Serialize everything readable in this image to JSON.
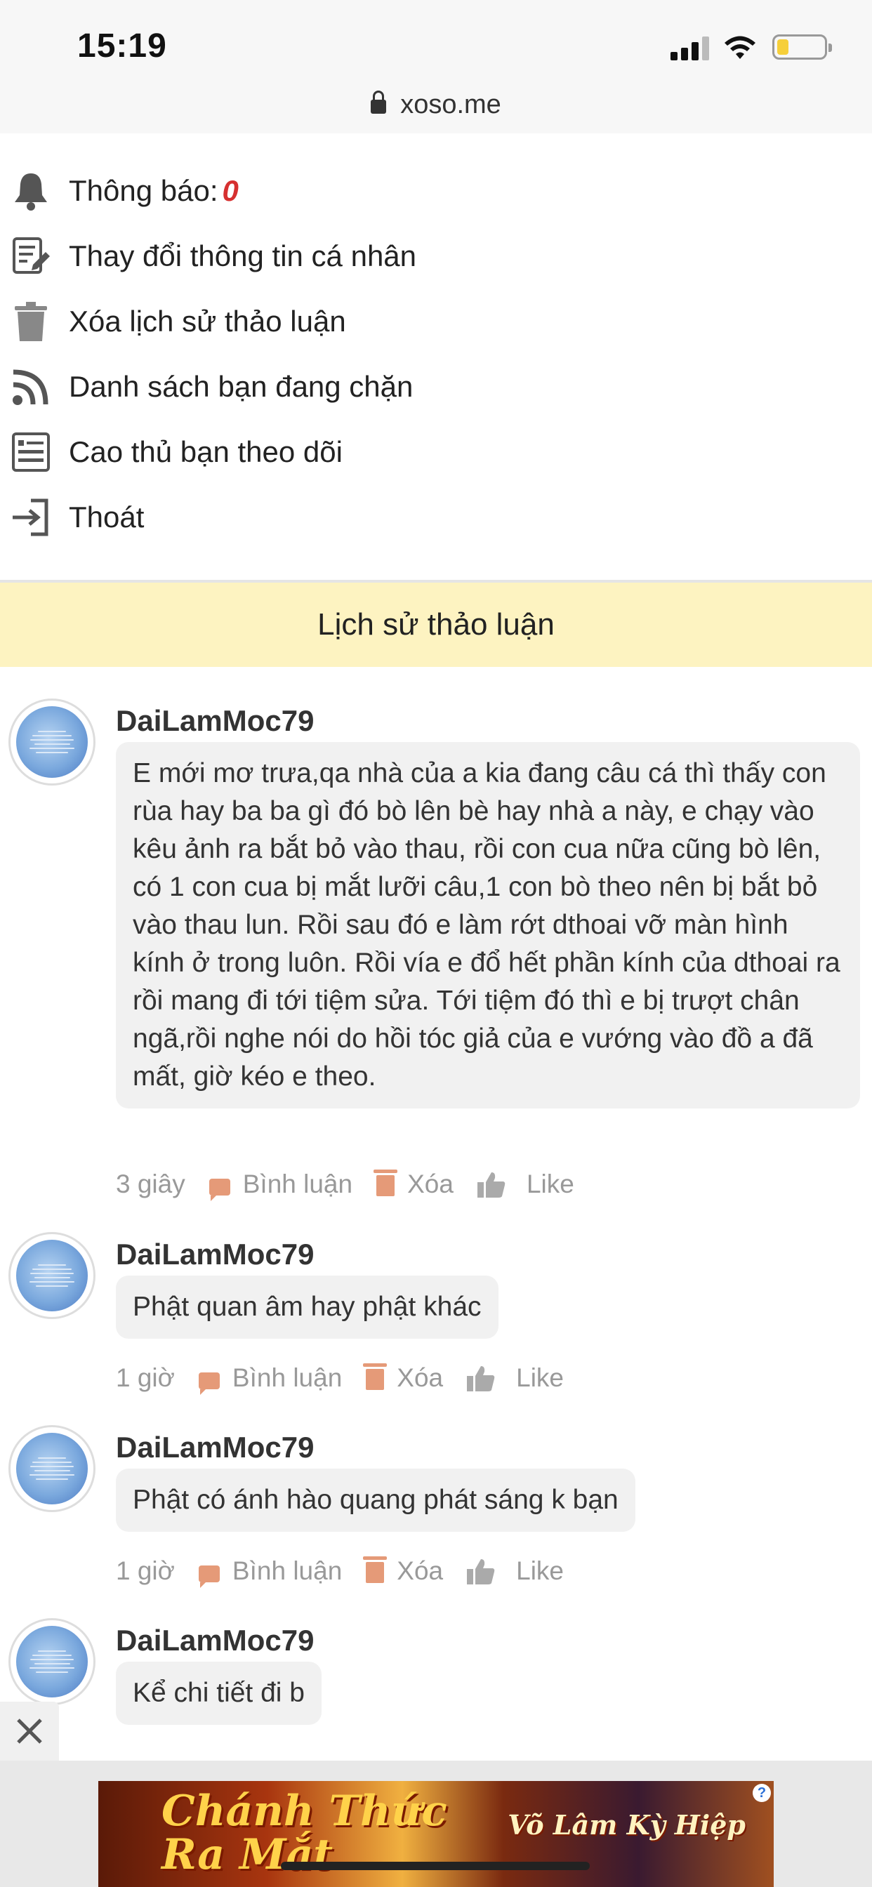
{
  "status_bar": {
    "time": "15:19"
  },
  "browser": {
    "url": "xoso.me"
  },
  "menu": {
    "notifications_label": "Thông báo:",
    "notifications_count": "0",
    "items": [
      {
        "label": "Thay đổi thông tin cá nhân",
        "icon": "edit-document-icon"
      },
      {
        "label": "Xóa lịch sử thảo luận",
        "icon": "trash-icon"
      },
      {
        "label": "Danh sách bạn đang chặn",
        "icon": "rss-icon"
      },
      {
        "label": "Cao thủ bạn theo dõi",
        "icon": "list-icon"
      },
      {
        "label": "Thoát",
        "icon": "logout-icon"
      }
    ]
  },
  "section_title": "Lịch sử thảo luận",
  "comments": [
    {
      "username": "DaiLamMoc79",
      "text": "E mới mơ trưa,qa nhà của a kia đang câu cá thì thấy con rùa hay ba ba gì đó bò lên bè hay nhà a này, e chạy vào kêu ảnh ra bắt bỏ vào thau, rồi con cua nữa cũng bò lên, có 1 con cua bị mắt lưỡi câu,1 con bò theo nên bị bắt bỏ vào thau lun. Rồi sau đó e làm rớt dthoai vỡ màn hình kính ở trong luôn. Rồi vía e đổ hết phần kính của dthoai ra rồi mang đi tới tiệm sửa. Tới tiệm đó thì e bị trượt chân ngã,rồi nghe nói do hồi tóc giả của e vướng vào đồ a đã mất, giờ kéo e theo.",
      "time": "3 giây"
    },
    {
      "username": "DaiLamMoc79",
      "text": "Phật quan âm hay phật khác",
      "time": "1 giờ"
    },
    {
      "username": "DaiLamMoc79",
      "text": "Phật có ánh hào quang phát sáng k bạn",
      "time": "1 giờ"
    },
    {
      "username": "DaiLamMoc79",
      "text": "Kể chi tiết đi b",
      "time": ""
    }
  ],
  "actions": {
    "comment_label": "Bình luận",
    "delete_label": "Xóa",
    "like_label": "Like"
  },
  "ad": {
    "title_line1": "Chánh Thức",
    "title_line2": "Ra Mắt",
    "brand": "Võ Lâm Kỳ Hiệp",
    "help": "?"
  },
  "colors": {
    "accent": "#e59a78",
    "header_bg": "#fdf3c1",
    "badge": "#d63030"
  }
}
